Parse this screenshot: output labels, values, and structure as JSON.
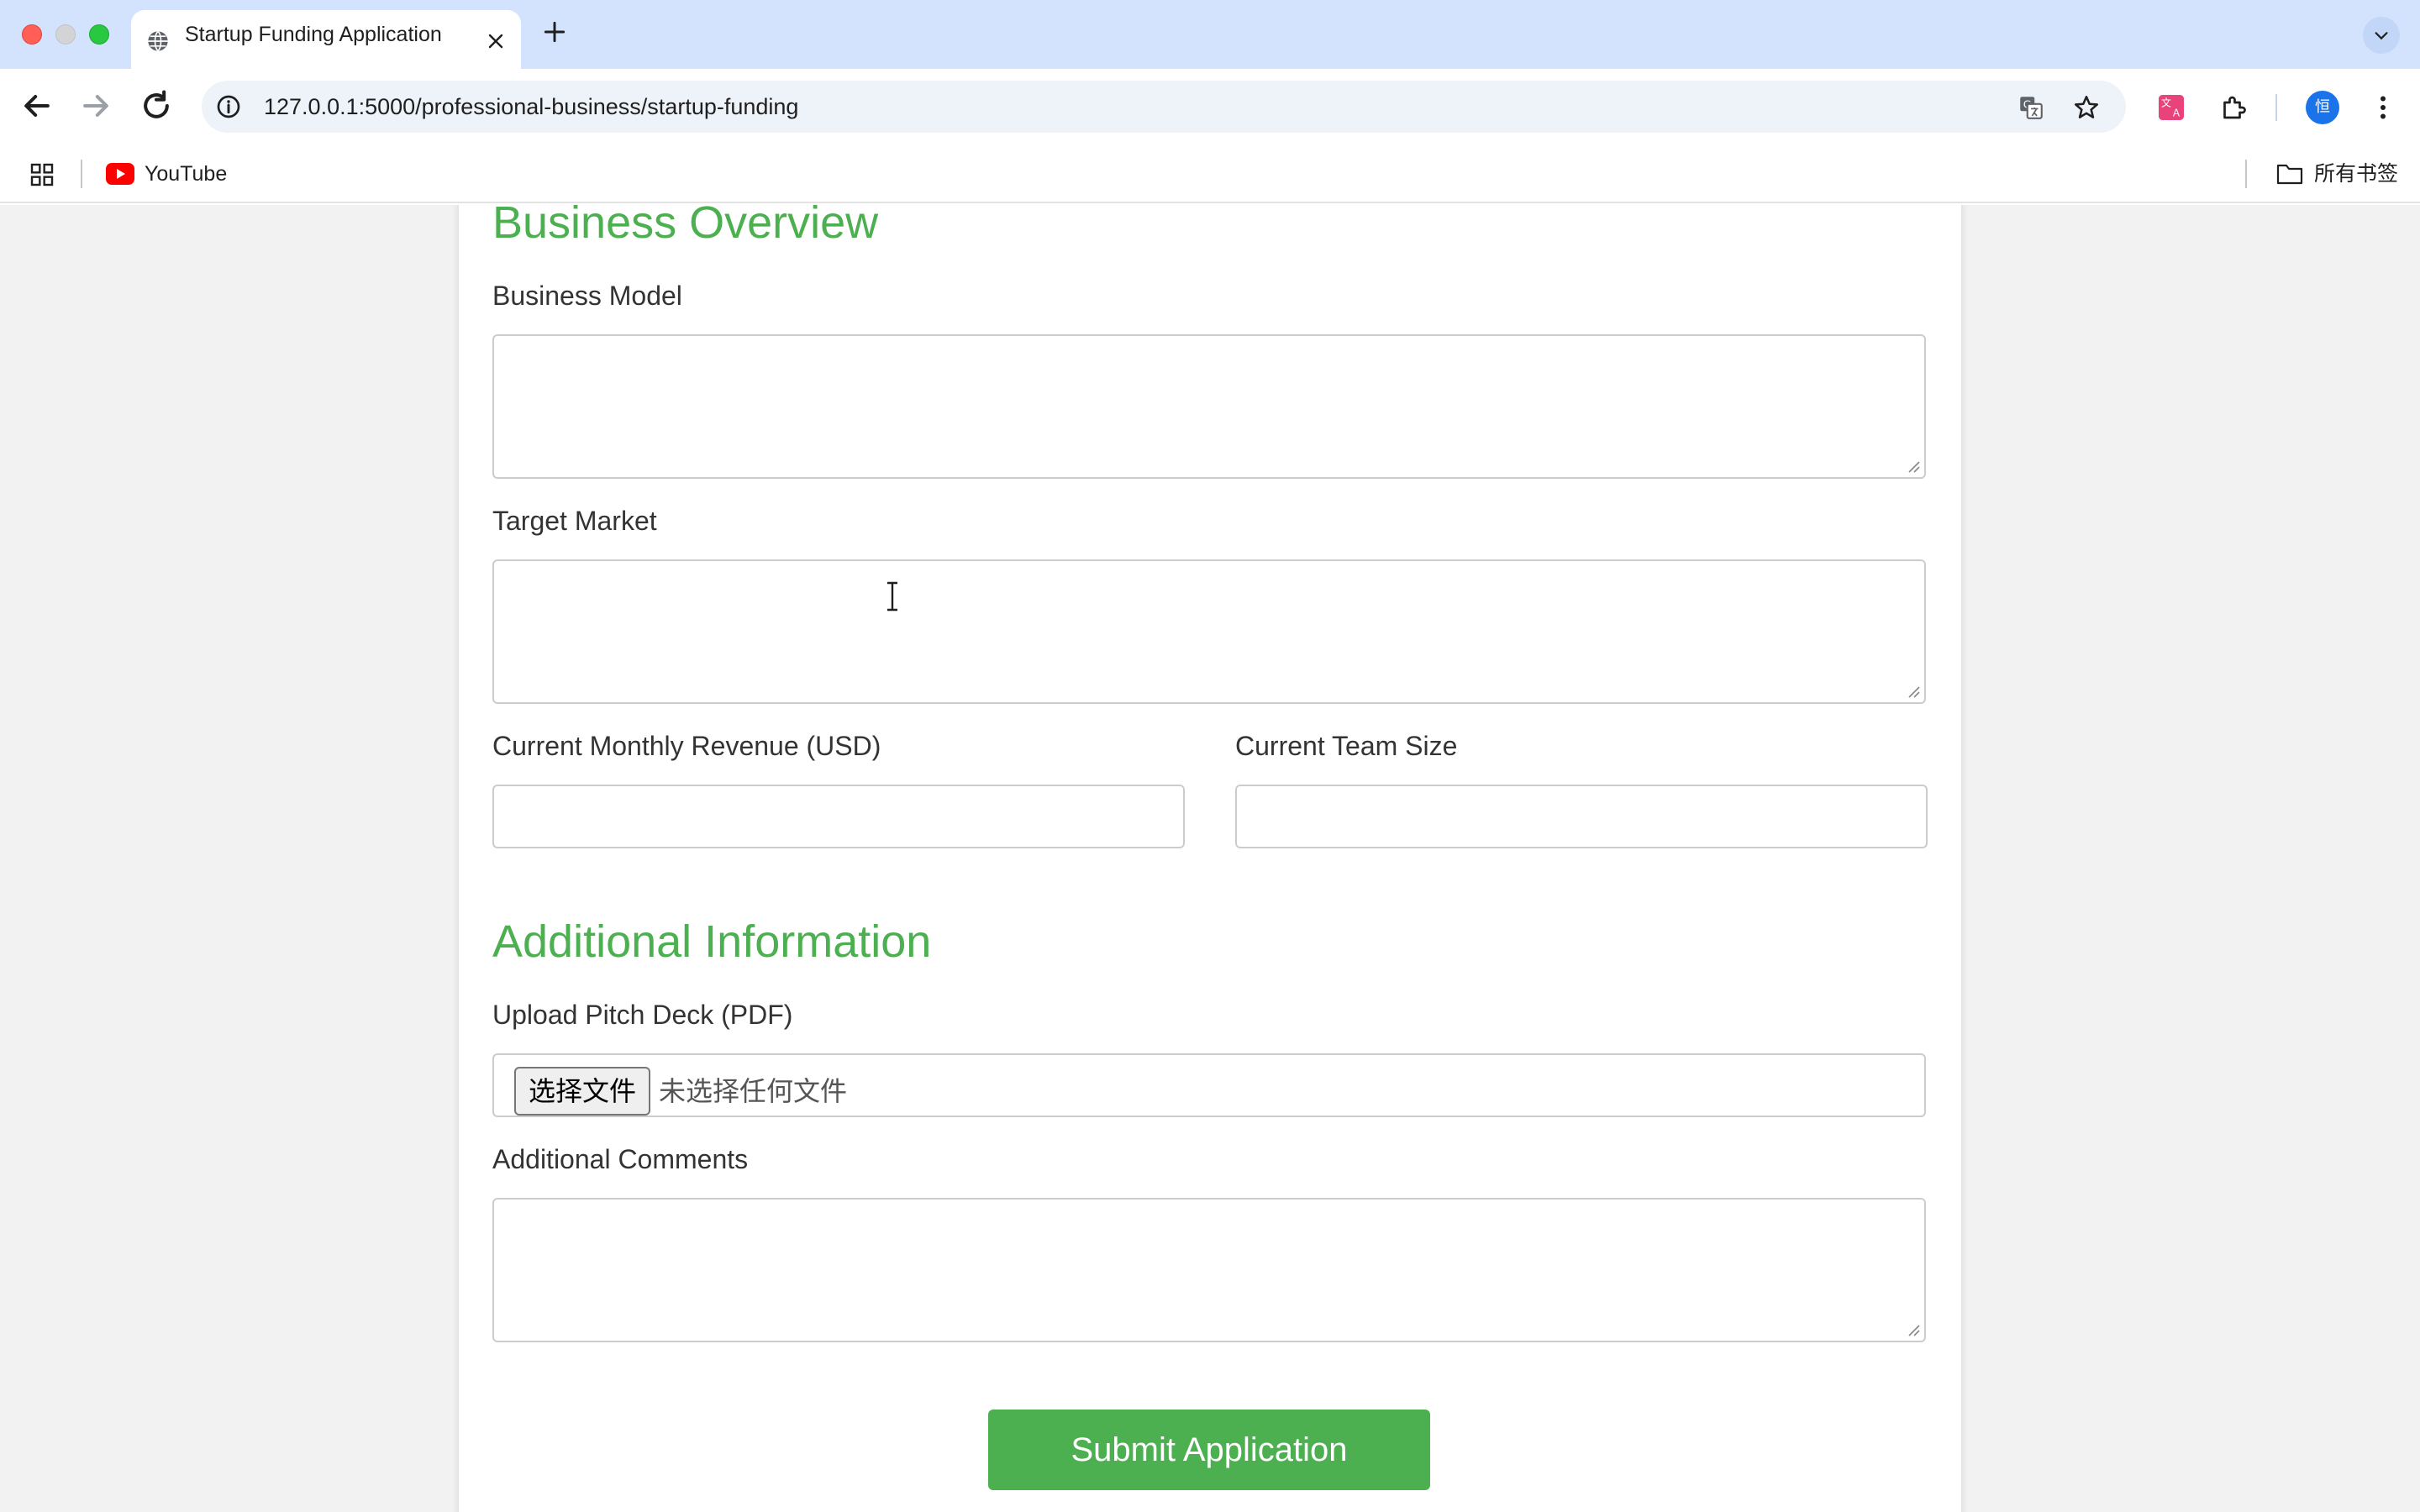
{
  "browser": {
    "tab": {
      "title": "Startup Funding Application",
      "favicon": "globe-icon"
    },
    "url": "127.0.0.1:5000/professional-business/startup-funding",
    "bookmarks": [
      {
        "label": "YouTube",
        "icon": "youtube-icon"
      }
    ],
    "all_bookmarks_label": "所有书签",
    "profile_initial": "恒"
  },
  "form": {
    "business_overview": {
      "title": "Business Overview",
      "business_model_label": "Business Model",
      "business_model_value": "",
      "target_market_label": "Target Market",
      "target_market_value": "",
      "monthly_revenue_label": "Current Monthly Revenue (USD)",
      "monthly_revenue_value": "",
      "team_size_label": "Current Team Size",
      "team_size_value": ""
    },
    "additional_information": {
      "title": "Additional Information",
      "pitch_deck_label": "Upload Pitch Deck (PDF)",
      "file_button_label": "选择文件",
      "file_status": "未选择任何文件",
      "comments_label": "Additional Comments",
      "comments_value": ""
    },
    "submit_label": "Submit Application"
  },
  "colors": {
    "accent": "#4caf50",
    "tabstrip": "#d3e3fd",
    "page_background": "#f2f2f2"
  }
}
